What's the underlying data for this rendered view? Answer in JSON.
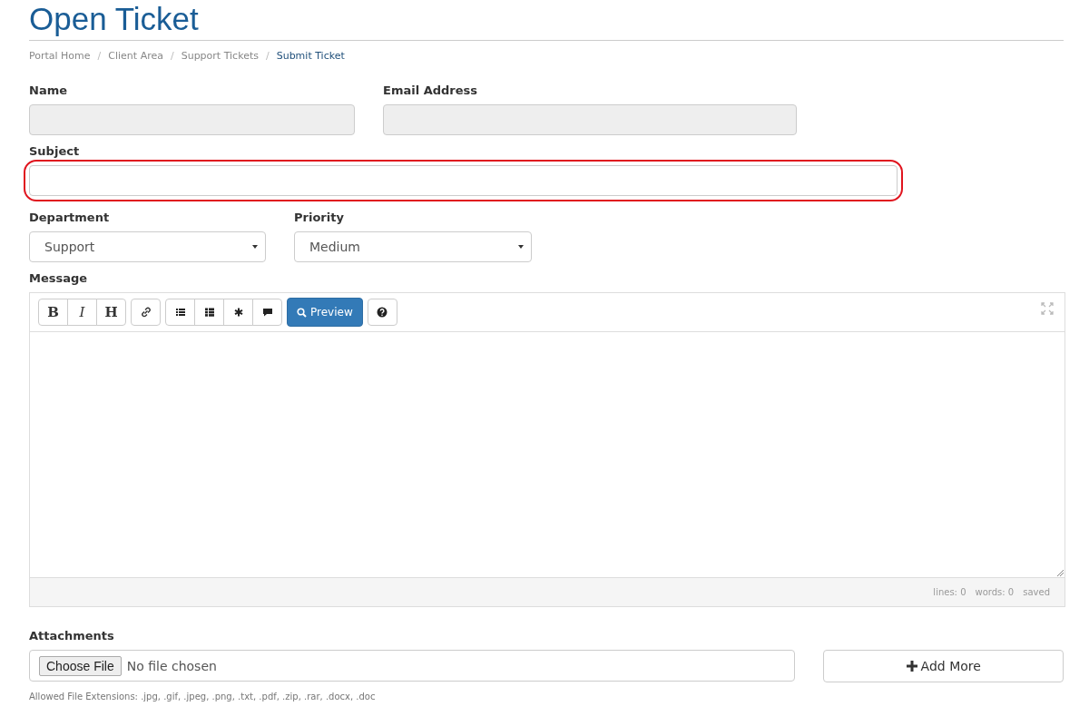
{
  "title": "Open Ticket",
  "breadcrumb_separator": "/",
  "breadcrumb": [
    {
      "label": "Portal Home",
      "current": false
    },
    {
      "label": "Client Area",
      "current": false
    },
    {
      "label": "Support Tickets",
      "current": false
    },
    {
      "label": "Submit Ticket",
      "current": true
    }
  ],
  "name": {
    "label": "Name",
    "disabled": true
  },
  "email": {
    "label": "Email Address",
    "disabled": true
  },
  "subject": {
    "label": "Subject",
    "disabled": false,
    "highlighted": true
  },
  "department": {
    "label": "Department",
    "value": "Support"
  },
  "priority": {
    "label": "Priority",
    "value": "Medium"
  },
  "message": {
    "label": "Message",
    "format_buttons": [
      "B",
      "I",
      "H"
    ],
    "preview_label": "Preview",
    "status": [
      "lines: 0",
      "words: 0",
      "saved"
    ]
  },
  "attachments": {
    "label": "Attachments",
    "choose_label": "Choose File",
    "file_status": "No file chosen",
    "add_more_label": "Add More",
    "help": "Allowed File Extensions: .jpg, .gif, .jpeg, .png, .txt, .pdf, .zip, .rar, .docx, .doc"
  }
}
